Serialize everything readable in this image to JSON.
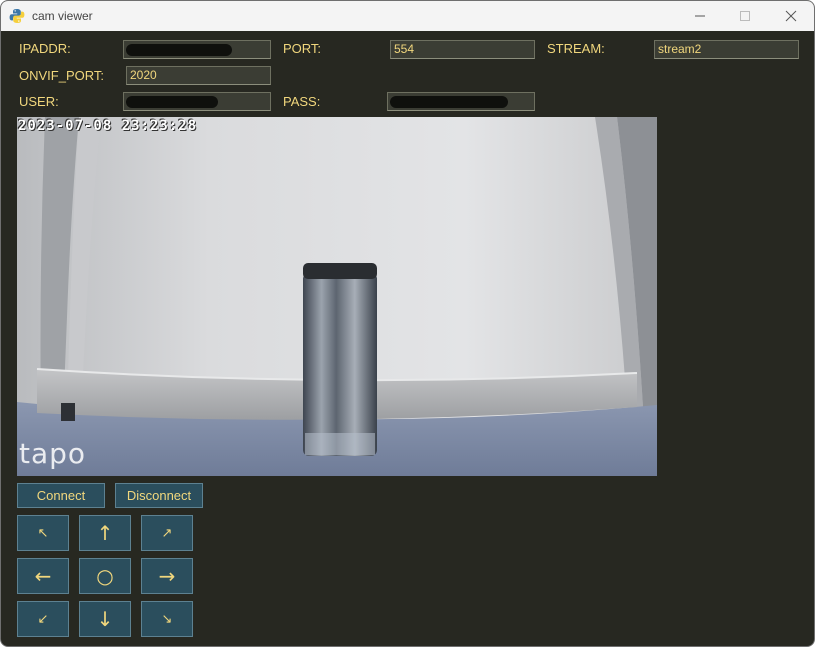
{
  "window": {
    "title": "cam viewer"
  },
  "form": {
    "ipaddr_label": "IPADDR:",
    "port_label": "PORT:",
    "port_value": "554",
    "stream_label": "STREAM:",
    "stream_value": "stream2",
    "onvif_port_label": "ONVIF_PORT:",
    "onvif_port_value": "2020",
    "user_label": "USER:",
    "pass_label": "PASS:"
  },
  "video": {
    "timestamp": "2023-07-08 23:23:28",
    "watermark": "tapo"
  },
  "buttons": {
    "connect": "Connect",
    "disconnect": "Disconnect"
  },
  "ptz": {
    "up_left": "↖",
    "up": "↑",
    "up_right": "↗",
    "left": "←",
    "home": "○",
    "right": "→",
    "down_left": "↙",
    "down": "↓",
    "down_right": "↘"
  },
  "colors": {
    "background": "#272821",
    "label_text": "#f1d77d",
    "button_fill": "#2b4e5d"
  }
}
